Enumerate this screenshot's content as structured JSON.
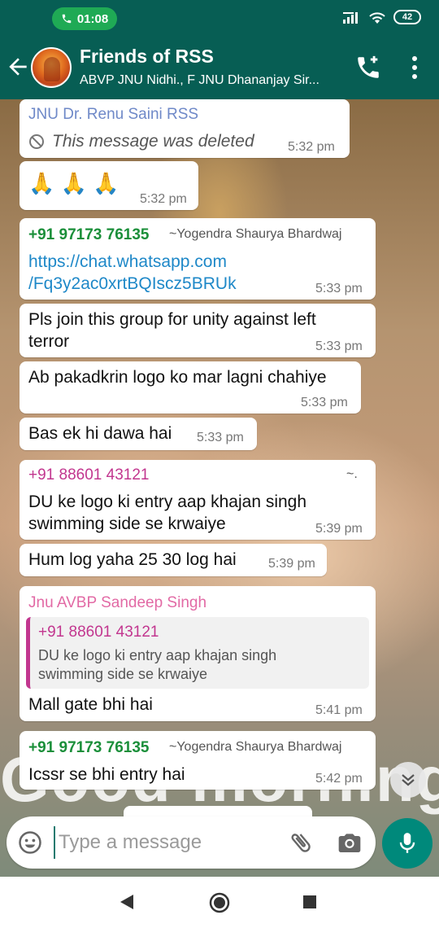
{
  "status_bar": {
    "time": "01:08",
    "battery": "42"
  },
  "header": {
    "title": "Friends of RSS",
    "subtitle": "ABVP JNU Nidhi., F JNU Dhananjay Sir..."
  },
  "messages": [
    {
      "sender": "JNU Dr. Renu Saini RSS",
      "text": "This message was deleted",
      "time": "5:32 pm"
    },
    {
      "text": "🙏 🙏 🙏",
      "time": "5:32 pm"
    },
    {
      "sender": "+91 97173 76135",
      "pushname": "~Yogendra Shaurya Bhardwaj",
      "text_line1": "https://chat.whatsapp.com",
      "text_line2": "/Fq3y2ac0xrtBQIscz5BRUk",
      "time": "5:33 pm"
    },
    {
      "text_line1": "Pls join this group for unity against left",
      "text_line2": "terror",
      "time": "5:33 pm"
    },
    {
      "text": "Ab pakadkrin logo ko mar lagni chahiye",
      "time": "5:33 pm"
    },
    {
      "text": "Bas ek hi dawa hai",
      "time": "5:33 pm"
    },
    {
      "sender": "+91 88601 43121",
      "pushname": "~.",
      "text_line1": "DU ke logo ki entry aap khajan singh",
      "text_line2": "swimming side se krwaiye",
      "time": "5:39 pm"
    },
    {
      "text": "Hum log yaha 25 30 log hai",
      "time": "5:39 pm"
    },
    {
      "sender": "Jnu AVBP Sandeep Singh",
      "quote_sender": "+91 88601 43121",
      "quote_line1": "DU ke logo ki entry aap khajan singh",
      "quote_line2": "swimming side se krwaiye",
      "text": "Mall gate bhi hai",
      "time": "5:41 pm"
    },
    {
      "sender": "+91 97173 76135",
      "pushname": "~Yogendra Shaurya Bhardwaj",
      "text": "Icssr se bhi entry hai",
      "time": "5:42 pm"
    }
  ],
  "wallpaper_text": "Good morning",
  "input": {
    "placeholder": "Type a message"
  },
  "colors": {
    "header": "#075e54",
    "sender_blue": "#6f89c8",
    "sender_green": "#1b8f3a",
    "sender_magenta": "#c2368f",
    "sender_pink": "#e26aa5",
    "link": "#1e88c8",
    "mic": "#00897b"
  },
  "icons": [
    "phone-icon",
    "signal-icon",
    "wifi-icon",
    "back-arrow-icon",
    "add-call-icon",
    "more-vert-icon",
    "blocked-icon",
    "chevron-double-down-icon",
    "emoji-icon",
    "attach-icon",
    "camera-icon",
    "mic-icon",
    "nav-back-icon",
    "nav-home-icon",
    "nav-recents-icon"
  ]
}
